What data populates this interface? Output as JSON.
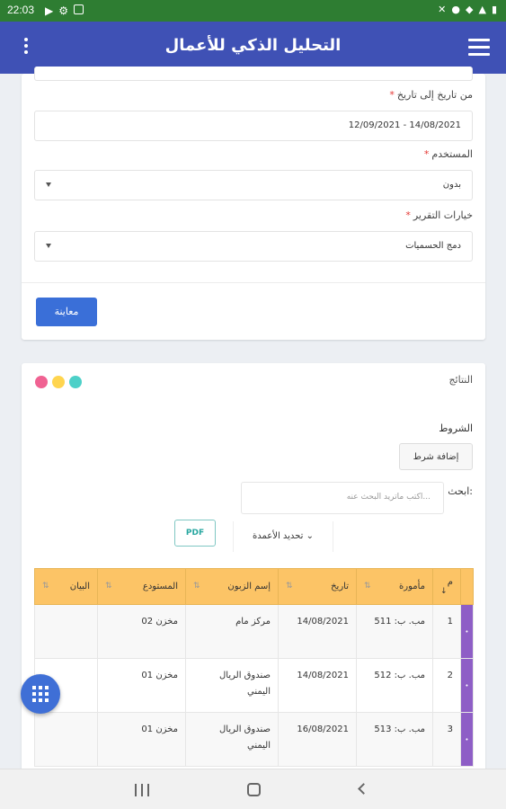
{
  "status_bar": {
    "time": "22:03"
  },
  "app_bar": {
    "title": "التحليل الذكي للأعمال"
  },
  "filters": {
    "date_range_label": "من تاريخ إلى تاريخ",
    "date_range_value": "12/09/2021 - 14/08/2021",
    "user_label": "المستخدم",
    "user_value": "بدون",
    "report_options_label": "خيارات التقرير",
    "report_options_value": "دمج الحسميات",
    "required_mark": "*",
    "preview_button": "معاينة"
  },
  "results": {
    "title": "النتائج",
    "conditions_label": "الشروط",
    "add_condition_button": "إضافة شرط",
    "search_label": "ابحث:",
    "search_placeholder": "اكتب ماتريد البحث عنه...",
    "columns_button": "تحديد الأعمدة ⌄",
    "pdf_button": "PDF",
    "dot_colors": [
      "#f06292",
      "#ffd54f",
      "#4dd0c8"
    ]
  },
  "table": {
    "headers": [
      "م",
      "مأمورة",
      "تاريخ",
      "إسم الزبون",
      "المستودع",
      "البيان"
    ],
    "sort_glyph": "⇅",
    "rows": [
      {
        "index": "1",
        "doc": "مب. ب: 511",
        "date": "14/08/2021",
        "customer": "مركز مام",
        "warehouse": "مخزن 02",
        "note": ""
      },
      {
        "index": "2",
        "doc": "مب. ب: 512",
        "date": "14/08/2021",
        "customer": "صندوق الريال اليمني",
        "warehouse": "مخزن 01",
        "note": ""
      },
      {
        "index": "3",
        "doc": "مب. ب: 513",
        "date": "16/08/2021",
        "customer": "صندوق الريال اليمني",
        "warehouse": "مخزن 01",
        "note": ""
      }
    ]
  },
  "colors": {
    "status_bar": "#2e7d32",
    "app_bar": "#3f51b5",
    "primary_button": "#3a6fd8",
    "table_header": "#fcc466",
    "row_handle": "#8e5ec6"
  }
}
